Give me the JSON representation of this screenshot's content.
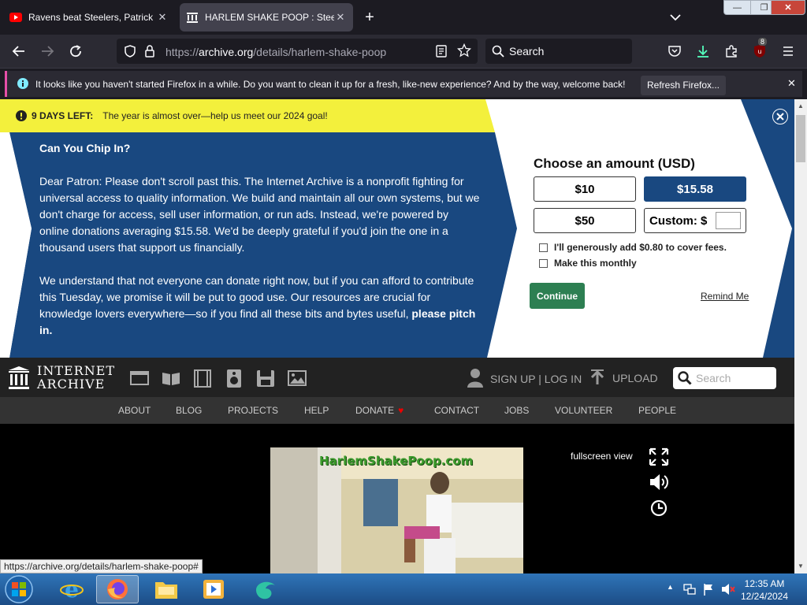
{
  "tabs": [
    {
      "title": "Ravens beat Steelers, Patrick M",
      "icon": "youtube-icon"
    },
    {
      "title": "HARLEM SHAKE POOP : Steezy",
      "icon": "archive-icon"
    }
  ],
  "navbar": {
    "url_prefix": "https://",
    "url_host": "archive.org",
    "url_path": "/details/harlem-shake-poop",
    "search_placeholder": "Search",
    "extensions_badge": "8"
  },
  "notification": {
    "message": "It looks like you haven't started Firefox in a while. Do you want to clean it up for a fresh, like-new experience? And by the way, welcome back!",
    "button": "Refresh Firefox..."
  },
  "banner": {
    "days_left": "9 DAYS LEFT:",
    "days_message": "The year is almost over—help us meet our 2024 goal!",
    "heading": "Can You Chip In?",
    "para1": "Dear Patron: Please don't scroll past this. The Internet Archive is a nonprofit fighting for universal access to quality information. We build and maintain all our own systems, but we don't charge for access, sell user information, or run ads. Instead, we're powered by online donations averaging $15.58. We'd be deeply grateful if you'd join the one in a thousand users that support us financially.",
    "para2": "We understand that not everyone can donate right now, but if you can afford to contribute this Tuesday, we promise it will be put to good use. Our resources are crucial for knowledge lovers everywhere—so if you find all these bits and bytes useful,",
    "para2_bold": "please pitch in.",
    "amount_title": "Choose an amount (USD)",
    "amounts": [
      "$10",
      "$15.58",
      "$50"
    ],
    "custom_label": "Custom: $",
    "fee_checkbox": "I'll generously add $0.80 to cover fees.",
    "monthly_checkbox": "Make this monthly",
    "continue": "Continue",
    "remind": "Remind Me"
  },
  "ia": {
    "logo_line1": "INTERNET",
    "logo_line2": "ARCHIVE",
    "signup": "SIGN UP | LOG IN",
    "upload": "UPLOAD",
    "search_placeholder": "Search",
    "menu": [
      "ABOUT",
      "BLOG",
      "PROJECTS",
      "HELP",
      "DONATE",
      "CONTACT",
      "JOBS",
      "VOLUNTEER",
      "PEOPLE"
    ]
  },
  "player": {
    "video_overlay": "HarlemShakePoop.com",
    "fullscreen": "fullscreen view"
  },
  "status_url": "https://archive.org/details/harlem-shake-poop#",
  "taskbar": {
    "time": "12:35 AM",
    "date": "12/24/2024"
  },
  "colors": {
    "banner_blue": "#194880",
    "banner_yellow": "#f3f03c",
    "continue_green": "#2d7f52",
    "firefox_dark": "#1c1b22",
    "notify_accent": "#e64fa8"
  }
}
